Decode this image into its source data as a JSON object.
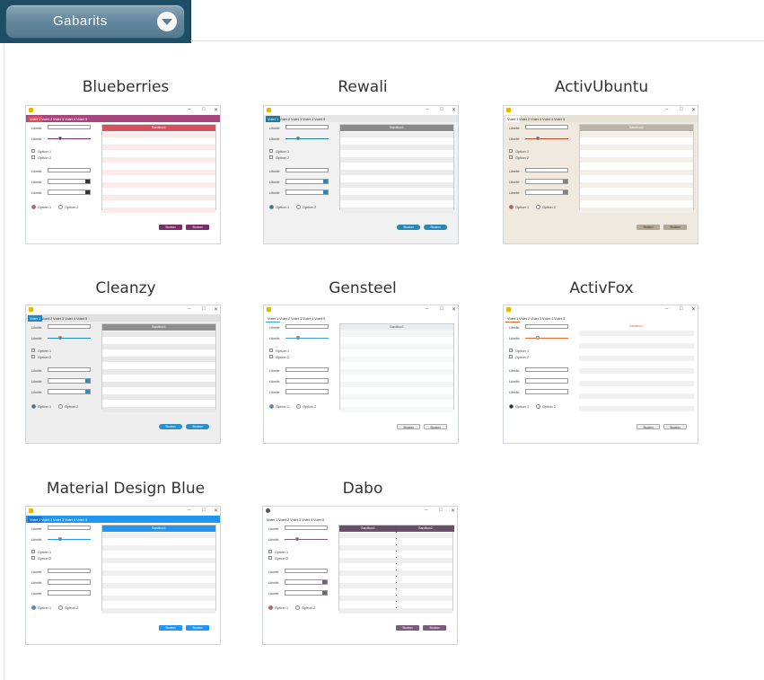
{
  "header": {
    "button_label": "Gabarits",
    "dropdown_icon": "chevron-down-icon"
  },
  "form": {
    "tabs": [
      "Volet 1",
      "Volet 2",
      "Volet 3",
      "Volet 4",
      "Volet 5"
    ],
    "field_label": "Libellé",
    "options": [
      "Option 1",
      "Option 2"
    ],
    "grid_column": "Sandbox1",
    "dabo_grid_columns": [
      "Sandbox1",
      "Sandbox2"
    ],
    "button_label": "Bouton",
    "window_controls": [
      "–",
      "□",
      "✕"
    ]
  },
  "templates": [
    {
      "name": "Blueberries",
      "accent": "#7b2d6b",
      "tabbar": "#a8477e",
      "window_bg": "#ffffff",
      "grid_head": "#d94f5c",
      "stripe": "#fbeaea",
      "btn": "#7b2d6b",
      "btn_text": "#ffffff",
      "sel_arrow": "#333333",
      "tab_text": "#ffffff"
    },
    {
      "name": "Rewali",
      "accent": "#1f7aa0",
      "tabbar": "#e6e6e6",
      "window_bg": "#f1f1f1",
      "grid_head": "#8a8a8a",
      "stripe": "#ececec",
      "btn": "#2a87b5",
      "btn_text": "#ffffff",
      "sel_arrow": "#2a87b5",
      "tab_text": "#333333"
    },
    {
      "name": "ActivUbuntu",
      "accent": "#c24b2b",
      "tabbar": "#e8e2d6",
      "window_bg": "#efe9df",
      "grid_head": "#bdb3a5",
      "stripe": "#f3efe8",
      "btn": "#b4a894",
      "btn_text": "#333333",
      "sel_arrow": "#8c8372",
      "tab_text": "#333333"
    },
    {
      "name": "Cleanzy",
      "accent": "#1e88c8",
      "tabbar": "#e0e0e0",
      "window_bg": "#eeeeee",
      "grid_head": "#8e8e8e",
      "stripe": "#e8e8e8",
      "btn": "#2a90cc",
      "btn_text": "#ffffff",
      "sel_arrow": "#2a90cc",
      "tab_text": "#333333"
    },
    {
      "name": "Gensteel",
      "accent": "#3aa0d0",
      "tabbar": "#ffffff",
      "window_bg": "#ffffff",
      "grid_head": "#e7edf1",
      "stripe": "#f4f6f8",
      "btn": "#eeeeee",
      "btn_text": "#333333",
      "sel_arrow": "#ffffff",
      "tab_text": "#333333"
    },
    {
      "name": "ActivFox",
      "accent": "#e46a2e",
      "tabbar": "#ffffff",
      "window_bg": "#ffffff",
      "grid_head": "#ffffff",
      "stripe": "#f0f0f0",
      "btn": "#eeeeee",
      "btn_text": "#333333",
      "sel_arrow": "#ffffff",
      "tab_text": "#333333"
    },
    {
      "name": "Material Design Blue",
      "accent": "#2196f3",
      "tabbar": "#2196f3",
      "window_bg": "#ffffff",
      "grid_head": "#2196f3",
      "stripe": "#efefef",
      "btn": "#2196f3",
      "btn_text": "#ffffff",
      "sel_arrow": "#ffffff",
      "tab_text": "#ffffff"
    },
    {
      "name": "Dabo",
      "accent": "#7e5a7e",
      "tabbar": "#ffffff",
      "window_bg": "#ffffff",
      "grid_head": "#6a4f6a",
      "stripe": "#efefef",
      "btn": "#7e5a7e",
      "btn_text": "#ffffff",
      "sel_arrow": "#7e5a7e",
      "tab_text": "#333333"
    }
  ]
}
